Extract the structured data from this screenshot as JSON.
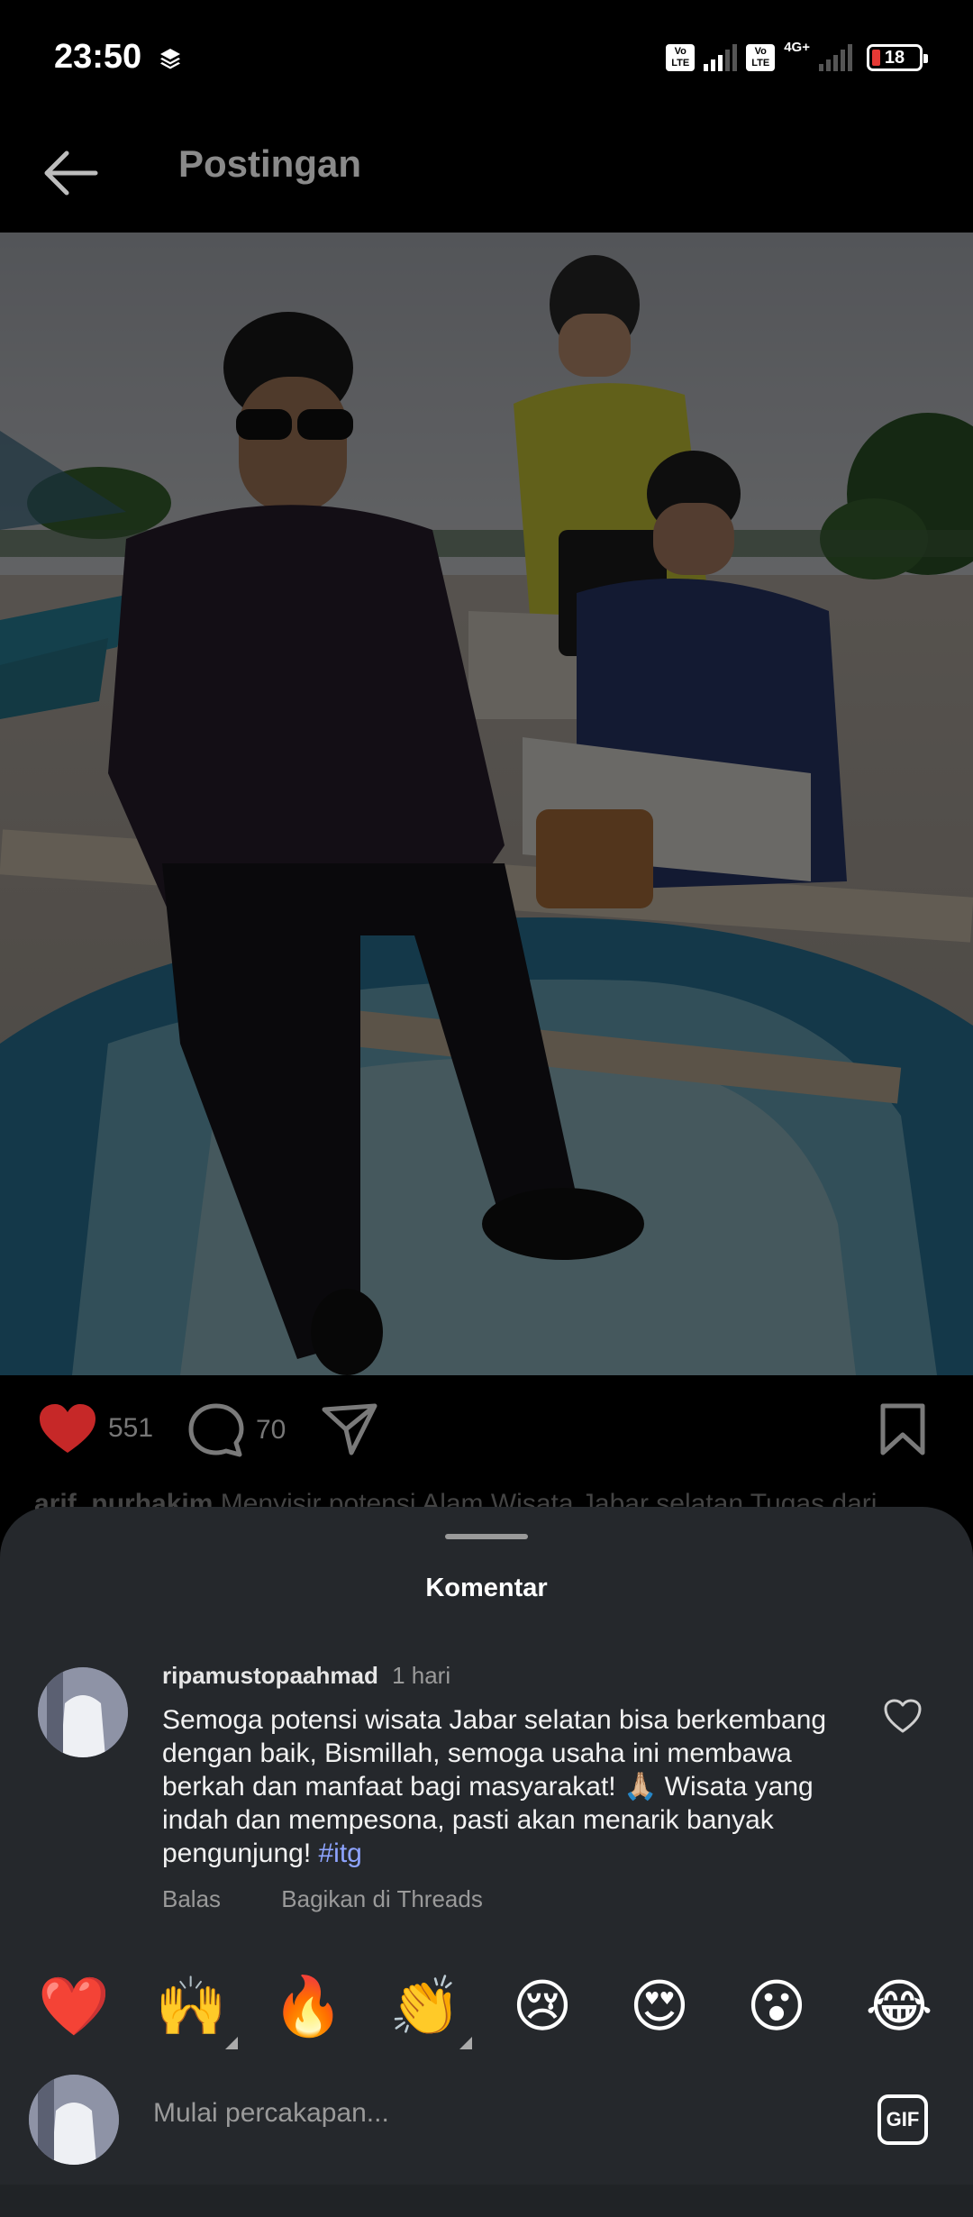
{
  "status_bar": {
    "time": "23:50",
    "volte_label": "Vo LTE",
    "network": "4G+",
    "battery": "18",
    "battery_level": 0.18
  },
  "header": {
    "title": "Postingan",
    "back_icon": "arrow-left-icon"
  },
  "post": {
    "likes": "551",
    "comments": "70",
    "caption_user": "arif_nurhakim",
    "caption_text": "Menyisir potensi Alam Wisata Jabar selatan Tugas dari"
  },
  "comments_sheet": {
    "title": "Komentar",
    "comment": {
      "username": "ripamustopaahmad",
      "time": "1 hari",
      "text_before_tag": "Semoga potensi wisata Jabar selatan bisa berkembang dengan baik, Bismillah, semoga usaha ini membawa berkah dan manfaat bagi masyarakat! 🙏🏼 Wisata yang indah dan mempesona, pasti akan menarik banyak pengunjung! ",
      "tag": "#itg",
      "reply_label": "Balas",
      "share_label": "Bagikan di Threads"
    },
    "emojis": [
      "❤️",
      "🙌",
      "🔥",
      "👏",
      "😢",
      "😍",
      "😮",
      "😂"
    ],
    "input": {
      "placeholder": "Mulai percakapan...",
      "gif_label": "GIF"
    }
  },
  "colors": {
    "heart": "#c62828",
    "sheet_bg": "#25282c",
    "hashtag": "#8ea4ff"
  }
}
